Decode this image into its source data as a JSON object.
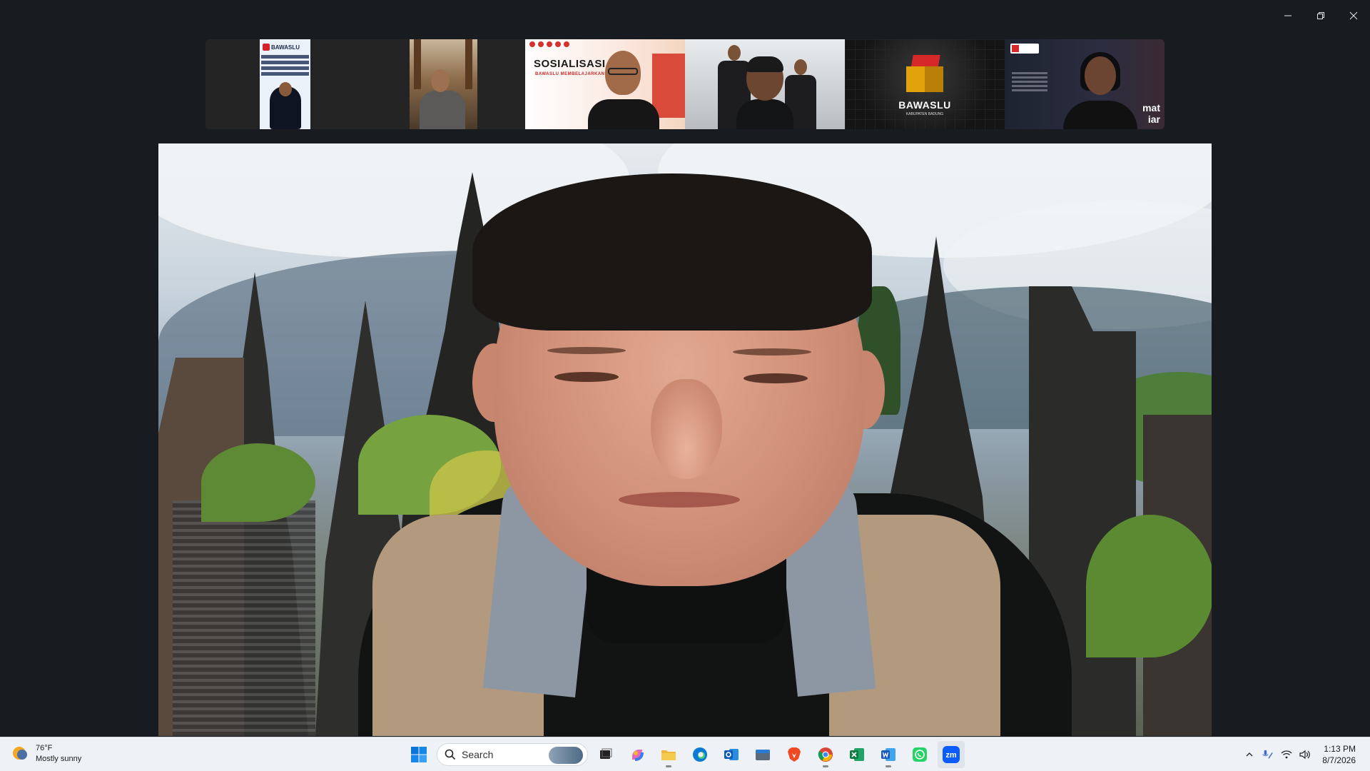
{
  "window": {
    "controls": [
      "minimize",
      "restore",
      "close"
    ]
  },
  "gallery": {
    "tiles": [
      {
        "id": "participant-1",
        "poster_brand": "BAWASLU"
      },
      {
        "id": "participant-2"
      },
      {
        "id": "participant-3",
        "banner_title": "SOSIALISASI",
        "banner_subtitle": "BAWASLU MEMBELAJARKAN"
      },
      {
        "id": "participant-4"
      },
      {
        "id": "participant-5",
        "brand": "BAWASLU",
        "brand_sub": "KABUPATEN BADUNG"
      },
      {
        "id": "participant-6",
        "words_1": "mat",
        "words_2": "iar"
      }
    ]
  },
  "taskbar": {
    "weather": {
      "temp": "76°F",
      "condition": "Mostly sunny"
    },
    "search_label": "Search",
    "apps": [
      "task-view",
      "copilot",
      "file-explorer",
      "edge",
      "outlook",
      "files-app",
      "brave",
      "chrome",
      "excel",
      "word",
      "whatsapp",
      "zoom"
    ],
    "zoom_label": "zm",
    "clock": {
      "time": "1:13 PM",
      "date": "8/7/2026"
    }
  },
  "colors": {
    "background": "#181c20",
    "taskbar": "#eef1f5",
    "accent": "#0b5cd5",
    "brand_red": "#d62828"
  }
}
